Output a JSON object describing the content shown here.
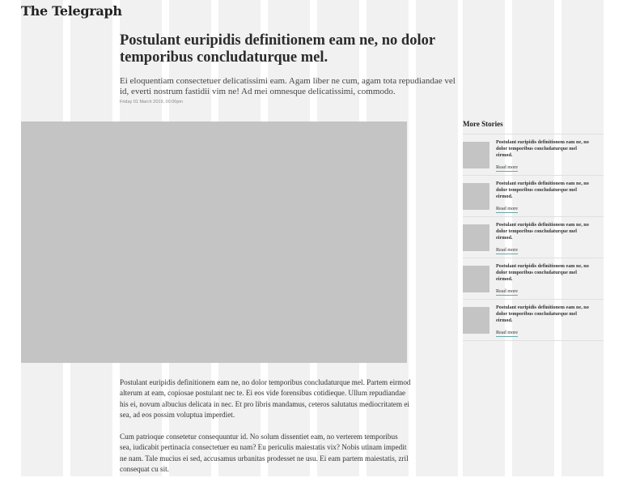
{
  "site": {
    "logo_text": "The Telegraph"
  },
  "article": {
    "headline": "Postulant euripidis definitionem eam ne, no dolor temporibus concludaturque mel.",
    "standfirst": "Ei eloquentiam consectetuer delicatissimi eam. Agam liber ne cum, agam tota repudiandae vel id, everti nostrum fastidii vim ne! Ad mei omnesque delicatissimi, commodo.",
    "dateline": "Friday 01 March 2019, 00:00pm",
    "paragraphs": [
      "Postulant euripidis definitionem eam ne, no dolor temporibus concludaturque mel. Partem eirmod alterum at eam, copiosae postulant nec te. Ei eos vide forensibus cotidieque. Ullum repudiandae his ei, novum albucius delicata in nec. Et pro libris mandamus, ceteros salutatus mediocritatem ei sea, ad eos possim voluptua imperdiet.",
      "Cum patrioque consetetur consequuntur id. No solum dissentiet eam, no verterem temporibus sea, iudicabit pertinacia consectetuer eu nam? Eu periculis maiestatis vix? Nobis utinam impedit ne nam. Tale mucius ei sed, accusamus urbanitas prodesset ne usu. Ei eam partem maiestatis, zril consequat cu sit."
    ]
  },
  "more_stories": {
    "title": "More Stories",
    "items": [
      {
        "title": "Postulant euripidis definitionem eam ne, no dolor temporibus concludaturque mel eirmod.",
        "link": "Read more"
      },
      {
        "title": "Postulant euripidis definitionem eam ne, no dolor temporibus concludaturque mel eirmod.",
        "link": "Read more"
      },
      {
        "title": "Postulant euripidis definitionem eam ne, no dolor temporibus concludaturque mel eirmod.",
        "link": "Read more"
      },
      {
        "title": "Postulant euripidis definitionem eam ne, no dolor temporibus concludaturque mel eirmod.",
        "link": "Read more"
      },
      {
        "title": "Postulant euripidis definitionem eam ne, no dolor temporibus concludaturque mel eirmod.",
        "link": "Read more"
      }
    ]
  },
  "colors": {
    "grid_column": "#f1f1f1",
    "image_placeholder": "#c4c4c4",
    "link_underline": "#6aa9a9"
  }
}
